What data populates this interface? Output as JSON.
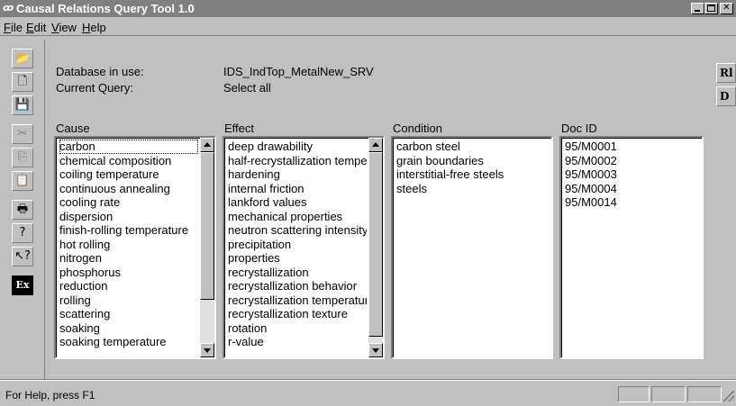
{
  "window": {
    "title": "Causal Relations Query Tool 1.0",
    "app_icon_glyph": "ꝏ",
    "close_glyph": "✕"
  },
  "menu": [
    {
      "label": "File",
      "ul": "F",
      "rest": "ile"
    },
    {
      "label": "Edit",
      "ul": "E",
      "rest": "dit"
    },
    {
      "label": "View",
      "ul": "V",
      "rest": "iew"
    },
    {
      "label": "Help",
      "ul": "H",
      "rest": "elp"
    }
  ],
  "toolbar_left": {
    "open": {
      "icon": "open-folder-icon",
      "glyph": "📂"
    },
    "new": {
      "icon": "new-document-icon",
      "glyph": "🗋"
    },
    "save": {
      "icon": "save-disk-icon",
      "glyph": "💾"
    },
    "cut": {
      "icon": "scissors-icon",
      "glyph": "✂"
    },
    "copy": {
      "icon": "copy-icon",
      "glyph": "⎘"
    },
    "paste": {
      "icon": "clipboard-icon",
      "glyph": "📋"
    },
    "print": {
      "icon": "printer-icon",
      "glyph": "🖶"
    },
    "help": {
      "icon": "question-icon",
      "glyph": "?"
    },
    "context_help": {
      "icon": "help-pointer-icon",
      "glyph": "↖?"
    },
    "ex": {
      "icon": "ex-icon",
      "glyph": "Ex"
    }
  },
  "toolbar_right": {
    "rl": "Rl",
    "d": "D"
  },
  "info": {
    "database_label": "Database in use:",
    "database_value": "IDS_IndTop_MetalNew_SRV",
    "query_label": "Current Query:",
    "query_value": "Select all"
  },
  "columns": {
    "cause": "Cause",
    "effect": "Effect",
    "condition": "Condition",
    "docid": "Doc ID"
  },
  "lists": {
    "cause": [
      "carbon",
      "chemical composition",
      "coiling temperature",
      "continuous annealing",
      "cooling rate",
      "dispersion",
      "finish-rolling temperature",
      "hot rolling",
      "nitrogen",
      "phosphorus",
      "reduction",
      "rolling",
      "scattering",
      "soaking",
      "soaking temperature"
    ],
    "effect": [
      "deep drawability",
      "half-recrystallization tempe",
      "hardening",
      "internal friction",
      "lankford values",
      "mechanical properties",
      "neutron scattering intensity",
      "precipitation",
      "properties",
      "recrystallization",
      "recrystallization behavior",
      "recrystallization temperatur",
      "recrystallization texture",
      "rotation",
      "r-value"
    ],
    "condition": [
      "carbon steel",
      "grain boundaries",
      "interstitial-free steels",
      "steels"
    ],
    "docid": [
      "95/M0001",
      "95/M0002",
      "95/M0003",
      "95/M0004",
      "95/M0014"
    ]
  },
  "status": {
    "text": "For Help, press F1"
  }
}
